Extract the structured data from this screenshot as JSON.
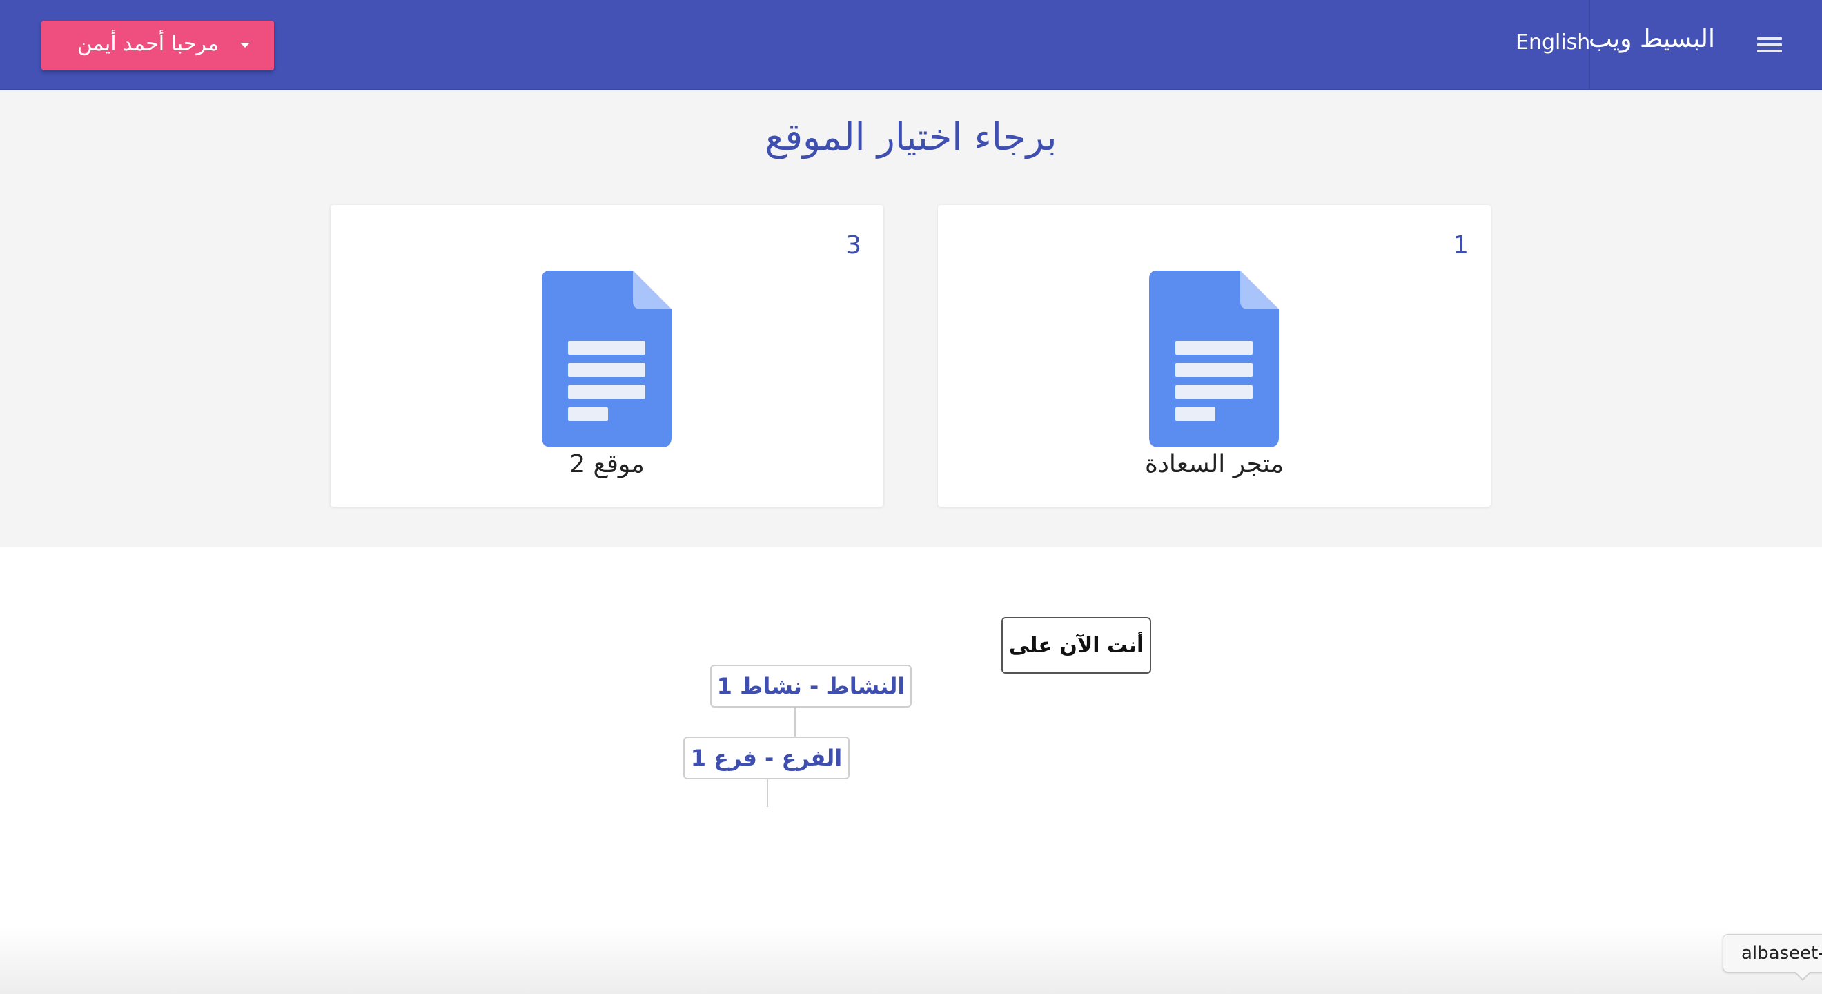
{
  "header": {
    "brand": "البسيط ويب",
    "language_link": "English",
    "user_menu_label": "مرحبا أحمد أيمن",
    "menu_icon": "hamburger-menu-icon",
    "dropdown_icon": "caret-down-icon"
  },
  "main": {
    "title": "برجاء اختيار الموقع",
    "sites": [
      {
        "number": "1",
        "name": "متجر السعادة",
        "icon": "document-icon"
      },
      {
        "number": "3",
        "name": "موقع 2",
        "icon": "document-icon"
      }
    ]
  },
  "breadcrumb": {
    "current_label": "أنت الآن على",
    "activity": "النشاط - نشاط 1",
    "branch": "الفرع - فرع 1"
  },
  "tooltip": {
    "text": "albaseet-"
  },
  "colors": {
    "header_bg": "#4352b4",
    "accent_pink": "#ef4f7f",
    "primary_text": "#3f4fb0",
    "doc_icon_blue": "#5b8df0"
  }
}
